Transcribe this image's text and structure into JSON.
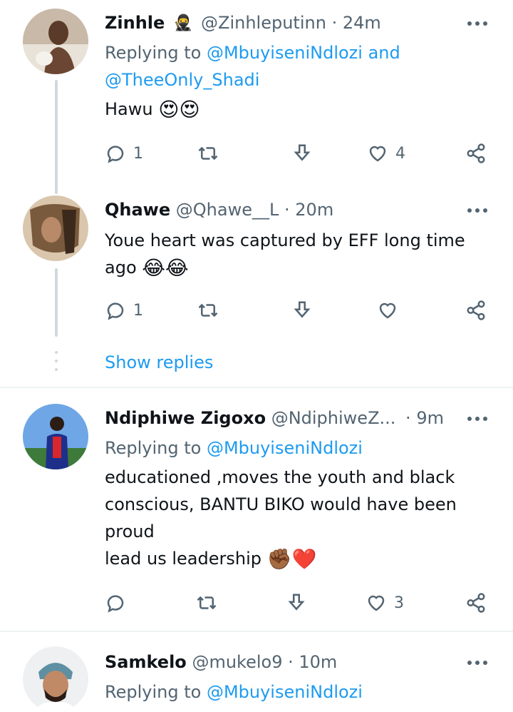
{
  "tweets": [
    {
      "name": "Zinhle",
      "name_emoji": "🥷",
      "handle": "@Zinhleputinn",
      "time": "24m",
      "replying_label": "Replying to",
      "replying_to": [
        "@MbuyiseniNdlozi",
        "@TheeOnly_Shadi"
      ],
      "replying_joiner": "and",
      "text": "Hawu",
      "emojis": "😍😍",
      "reply_count": "1",
      "retweet_count": "",
      "like_count": "4"
    },
    {
      "name": "Qhawe",
      "handle": "@Qhawe__L",
      "time": "20m",
      "text_line1": "Youe heart was captured by EFF long time",
      "text_line2": "ago",
      "emojis": "😂😂",
      "reply_count": "1",
      "retweet_count": "",
      "like_count": ""
    },
    {
      "name": "Ndiphiwe Zigoxo",
      "handle": "@NdiphiweZ...",
      "time": "9m",
      "replying_label": "Replying to",
      "replying_to": [
        "@MbuyiseniNdlozi"
      ],
      "text_lines": [
        "educationed ,moves the youth and black",
        "conscious, BANTU BIKO would have been",
        "proud",
        "lead us leadership"
      ],
      "emojis": "✊🏾❤️",
      "reply_count": "",
      "retweet_count": "",
      "like_count": "3"
    },
    {
      "name": "Samkelo",
      "handle": "@mukelo9",
      "time": "10m",
      "replying_label": "Replying to",
      "replying_to": [
        "@MbuyiseniNdlozi"
      ]
    }
  ],
  "show_replies_label": "Show replies",
  "separator": "·",
  "icons": [
    "more-icon",
    "reply-icon",
    "retweet-icon",
    "download-icon",
    "like-icon",
    "share-icon"
  ],
  "colors": {
    "link": "#1d9bf0",
    "secondary": "#536471",
    "text": "#0f1419",
    "thread": "#cfd9de"
  }
}
